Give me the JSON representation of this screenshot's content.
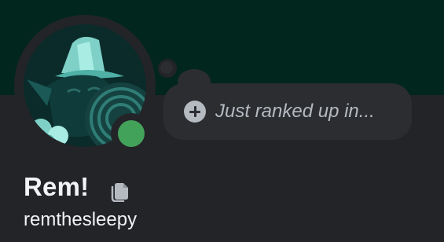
{
  "profile": {
    "display_name": "Rem!",
    "username": "remthesleepy",
    "status": "online",
    "custom_status_placeholder": "Just ranked up in...",
    "avatar_alt": "user-avatar"
  },
  "icons": {
    "add_status": "plus-circle-icon",
    "badge": "nitro-like-badge-icon"
  },
  "colors": {
    "banner": "#01261d",
    "panel": "#232428",
    "bubble": "#2b2d31",
    "status_online": "#43a25a",
    "text_primary": "#f2f3f5",
    "text_muted": "#b5bac1"
  }
}
